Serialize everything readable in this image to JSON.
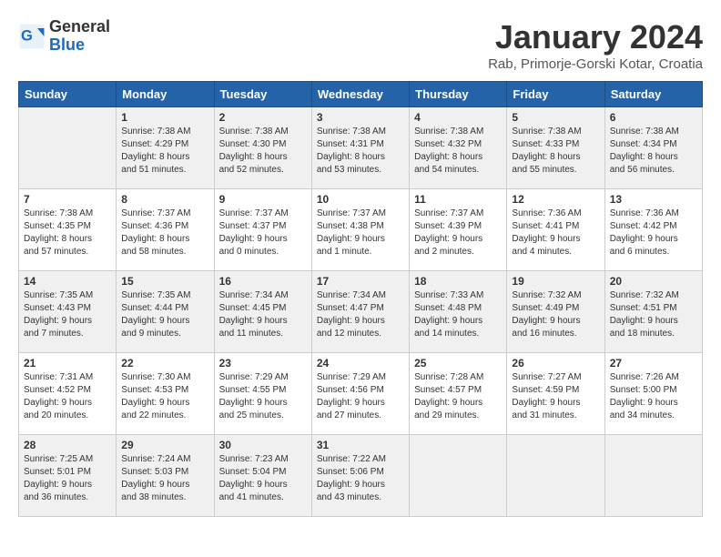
{
  "header": {
    "logo_general": "General",
    "logo_blue": "Blue",
    "month_title": "January 2024",
    "location": "Rab, Primorje-Gorski Kotar, Croatia"
  },
  "weekdays": [
    "Sunday",
    "Monday",
    "Tuesday",
    "Wednesday",
    "Thursday",
    "Friday",
    "Saturday"
  ],
  "weeks": [
    [
      {
        "day": "",
        "info": ""
      },
      {
        "day": "1",
        "info": "Sunrise: 7:38 AM\nSunset: 4:29 PM\nDaylight: 8 hours\nand 51 minutes."
      },
      {
        "day": "2",
        "info": "Sunrise: 7:38 AM\nSunset: 4:30 PM\nDaylight: 8 hours\nand 52 minutes."
      },
      {
        "day": "3",
        "info": "Sunrise: 7:38 AM\nSunset: 4:31 PM\nDaylight: 8 hours\nand 53 minutes."
      },
      {
        "day": "4",
        "info": "Sunrise: 7:38 AM\nSunset: 4:32 PM\nDaylight: 8 hours\nand 54 minutes."
      },
      {
        "day": "5",
        "info": "Sunrise: 7:38 AM\nSunset: 4:33 PM\nDaylight: 8 hours\nand 55 minutes."
      },
      {
        "day": "6",
        "info": "Sunrise: 7:38 AM\nSunset: 4:34 PM\nDaylight: 8 hours\nand 56 minutes."
      }
    ],
    [
      {
        "day": "7",
        "info": "Sunrise: 7:38 AM\nSunset: 4:35 PM\nDaylight: 8 hours\nand 57 minutes."
      },
      {
        "day": "8",
        "info": "Sunrise: 7:37 AM\nSunset: 4:36 PM\nDaylight: 8 hours\nand 58 minutes."
      },
      {
        "day": "9",
        "info": "Sunrise: 7:37 AM\nSunset: 4:37 PM\nDaylight: 9 hours\nand 0 minutes."
      },
      {
        "day": "10",
        "info": "Sunrise: 7:37 AM\nSunset: 4:38 PM\nDaylight: 9 hours\nand 1 minute."
      },
      {
        "day": "11",
        "info": "Sunrise: 7:37 AM\nSunset: 4:39 PM\nDaylight: 9 hours\nand 2 minutes."
      },
      {
        "day": "12",
        "info": "Sunrise: 7:36 AM\nSunset: 4:41 PM\nDaylight: 9 hours\nand 4 minutes."
      },
      {
        "day": "13",
        "info": "Sunrise: 7:36 AM\nSunset: 4:42 PM\nDaylight: 9 hours\nand 6 minutes."
      }
    ],
    [
      {
        "day": "14",
        "info": "Sunrise: 7:35 AM\nSunset: 4:43 PM\nDaylight: 9 hours\nand 7 minutes."
      },
      {
        "day": "15",
        "info": "Sunrise: 7:35 AM\nSunset: 4:44 PM\nDaylight: 9 hours\nand 9 minutes."
      },
      {
        "day": "16",
        "info": "Sunrise: 7:34 AM\nSunset: 4:45 PM\nDaylight: 9 hours\nand 11 minutes."
      },
      {
        "day": "17",
        "info": "Sunrise: 7:34 AM\nSunset: 4:47 PM\nDaylight: 9 hours\nand 12 minutes."
      },
      {
        "day": "18",
        "info": "Sunrise: 7:33 AM\nSunset: 4:48 PM\nDaylight: 9 hours\nand 14 minutes."
      },
      {
        "day": "19",
        "info": "Sunrise: 7:32 AM\nSunset: 4:49 PM\nDaylight: 9 hours\nand 16 minutes."
      },
      {
        "day": "20",
        "info": "Sunrise: 7:32 AM\nSunset: 4:51 PM\nDaylight: 9 hours\nand 18 minutes."
      }
    ],
    [
      {
        "day": "21",
        "info": "Sunrise: 7:31 AM\nSunset: 4:52 PM\nDaylight: 9 hours\nand 20 minutes."
      },
      {
        "day": "22",
        "info": "Sunrise: 7:30 AM\nSunset: 4:53 PM\nDaylight: 9 hours\nand 22 minutes."
      },
      {
        "day": "23",
        "info": "Sunrise: 7:29 AM\nSunset: 4:55 PM\nDaylight: 9 hours\nand 25 minutes."
      },
      {
        "day": "24",
        "info": "Sunrise: 7:29 AM\nSunset: 4:56 PM\nDaylight: 9 hours\nand 27 minutes."
      },
      {
        "day": "25",
        "info": "Sunrise: 7:28 AM\nSunset: 4:57 PM\nDaylight: 9 hours\nand 29 minutes."
      },
      {
        "day": "26",
        "info": "Sunrise: 7:27 AM\nSunset: 4:59 PM\nDaylight: 9 hours\nand 31 minutes."
      },
      {
        "day": "27",
        "info": "Sunrise: 7:26 AM\nSunset: 5:00 PM\nDaylight: 9 hours\nand 34 minutes."
      }
    ],
    [
      {
        "day": "28",
        "info": "Sunrise: 7:25 AM\nSunset: 5:01 PM\nDaylight: 9 hours\nand 36 minutes."
      },
      {
        "day": "29",
        "info": "Sunrise: 7:24 AM\nSunset: 5:03 PM\nDaylight: 9 hours\nand 38 minutes."
      },
      {
        "day": "30",
        "info": "Sunrise: 7:23 AM\nSunset: 5:04 PM\nDaylight: 9 hours\nand 41 minutes."
      },
      {
        "day": "31",
        "info": "Sunrise: 7:22 AM\nSunset: 5:06 PM\nDaylight: 9 hours\nand 43 minutes."
      },
      {
        "day": "",
        "info": ""
      },
      {
        "day": "",
        "info": ""
      },
      {
        "day": "",
        "info": ""
      }
    ]
  ]
}
